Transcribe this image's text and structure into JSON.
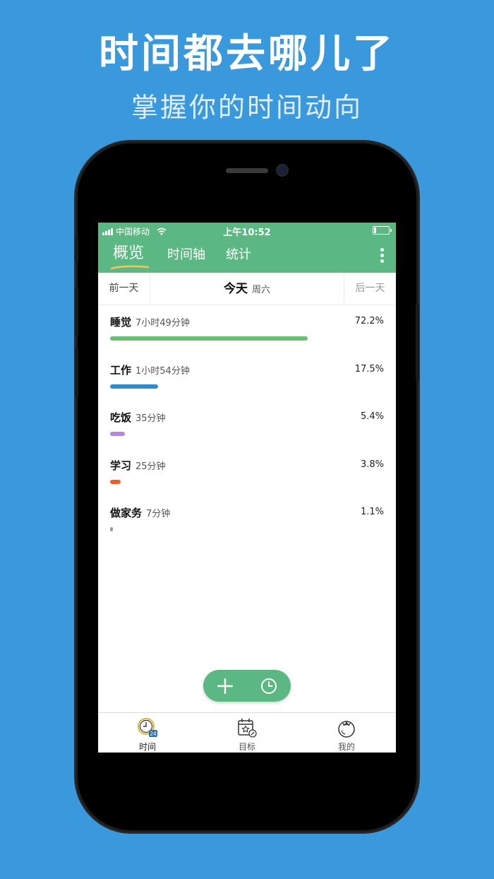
{
  "promo": {
    "headline": "时间都去哪儿了",
    "subline": "掌握你的时间动向"
  },
  "status_bar": {
    "carrier": "中国移动",
    "time": "上午10:52",
    "wifi_icon": "wifi-icon",
    "battery_icon": "battery-icon"
  },
  "app_bar": {
    "tabs": [
      {
        "label": "概览",
        "active": true
      },
      {
        "label": "时间轴",
        "active": false
      },
      {
        "label": "统计",
        "active": false
      }
    ],
    "more_icon": "more-vertical-icon"
  },
  "day_nav": {
    "prev_label": "前一天",
    "today_label": "今天",
    "weekday": "周六",
    "next_label": "后一天"
  },
  "activities": [
    {
      "name": "睡觉",
      "duration": "7小时49分钟",
      "percent": "72.2%",
      "fraction": 0.722,
      "color": "#6abf75"
    },
    {
      "name": "工作",
      "duration": "1小时54分钟",
      "percent": "17.5%",
      "fraction": 0.175,
      "color": "#2f8bc9"
    },
    {
      "name": "吃饭",
      "duration": "35分钟",
      "percent": "5.4%",
      "fraction": 0.054,
      "color": "#b088e0"
    },
    {
      "name": "学习",
      "duration": "25分钟",
      "percent": "3.8%",
      "fraction": 0.038,
      "color": "#e8602a"
    },
    {
      "name": "做家务",
      "duration": "7分钟",
      "percent": "1.1%",
      "fraction": 0.011,
      "color": "#9a9a9a"
    }
  ],
  "fab": {
    "add_icon": "plus-icon",
    "timer_icon": "clock-icon"
  },
  "bottom_nav": {
    "items": [
      {
        "label": "时间",
        "icon": "clock-24-icon",
        "active": true
      },
      {
        "label": "目标",
        "icon": "calendar-star-icon",
        "active": false
      },
      {
        "label": "我的",
        "icon": "tomato-icon",
        "active": false
      }
    ]
  },
  "colors": {
    "background": "#3a98dc",
    "brand_green": "#5bb882"
  }
}
